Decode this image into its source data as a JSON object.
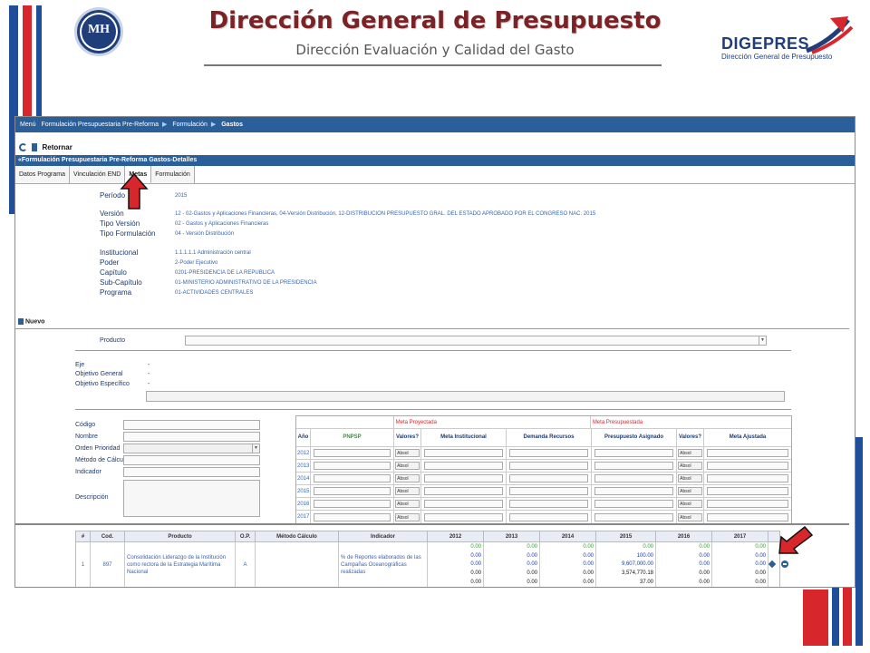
{
  "slide": {
    "title": "Dirección General de Presupuesto",
    "subtitle": "Dirección Evaluación y Calidad del Gasto",
    "seal_label": "MH",
    "brand_name": "DIGEPRES",
    "brand_sub": "Dirección General de Presupuesto"
  },
  "breadcrumb": [
    "Menú",
    "Formulación Presupuestaria Pre-Reforma",
    "Formulación",
    "Gastos"
  ],
  "toolbar": {
    "retornar_label": "Retornar"
  },
  "section_title": "Formulación Presupuestaria Pre-Reforma Gastos-Detalles",
  "tabs": [
    {
      "label": "Datos Programa",
      "active": false
    },
    {
      "label": "Vinculación END",
      "active": false
    },
    {
      "label": "Metas",
      "active": true
    },
    {
      "label": "Formulación",
      "active": false
    }
  ],
  "info": {
    "periodo_label": "Período",
    "periodo": "2015",
    "version_label": "Versión",
    "version": "12 - 02-Gastos y Aplicaciones Financieras, 04-Versión Distribución, 12-DISTRIBUCION PRESUPUESTO GRAL. DEL ESTADO APROBADO POR EL CONGRESO NAC. 2015",
    "tipo_version_label": "Tipo Versión",
    "tipo_version": "02 - Gastos y Aplicaciones Financieras",
    "tipo_formulacion_label": "Tipo Formulación",
    "tipo_formulacion": "04 - Versión Distribución",
    "institucional_label": "Institucional",
    "institucional": "1.1.1.1.1 Administración central",
    "poder_label": "Poder",
    "poder": "2-Poder Ejecutivo",
    "capitulo_label": "Capítulo",
    "capitulo": "0201-PRESIDENCIA DE LA REPUBLICA",
    "subcapitulo_label": "Sub-Capítulo",
    "subcapitulo": "01-MINISTERIO ADMINISTRATIVO DE LA PRESIDENCIA",
    "programa_label": "Programa",
    "programa": "01-ACTIVIDADES CENTRALES"
  },
  "nuevo_label": "Nuevo",
  "form": {
    "producto_label": "Producto",
    "eje_label": "Eje",
    "eje": "-",
    "objetivo_general_label": "Objetivo General",
    "objetivo_general": "-",
    "objetivo_especifico_label": "Objetivo Específico",
    "objetivo_especifico": "-",
    "codigo_label": "Código",
    "nombre_label": "Nombre",
    "orden_prioridad_label": "Orden Prioridad",
    "metodo_calculo_label": "Método de Cálculo",
    "indicador_label": "Indicador",
    "descripcion_label": "Descripción"
  },
  "goals_grid": {
    "meta_proyectada": "Meta Proyectada",
    "meta_presupuestada": "Meta Presupuestada",
    "headers": [
      "Año",
      "PNPSP",
      "Valores?",
      "Meta Institucional",
      "Demanda Recursos",
      "Presupuesto Asignado",
      "Valores?",
      "Meta Ajustada"
    ],
    "years": [
      "2012",
      "2013",
      "2014",
      "2015",
      "2016",
      "2017"
    ],
    "select_value": "Absol"
  },
  "results_table": {
    "headers": [
      "#",
      "Cod.",
      "Producto",
      "O.P.",
      "Método Cálculo",
      "Indicador",
      "2012",
      "2013",
      "2014",
      "2015",
      "2016",
      "2017"
    ],
    "row": {
      "num": "1",
      "cod": "897",
      "producto": "Consolidación Liderazgo de la Institución como rectora de la Estrategia Marítima Nacional",
      "op": "A",
      "metodo": "",
      "indicador": "% de Reportes elaborados de las Campañas Oceanográficas realizadas",
      "y2012": [
        "0.00",
        "0.00",
        "0.00",
        "0.00",
        "0.00"
      ],
      "y2013": [
        "0.00",
        "0.00",
        "0.00",
        "0.00",
        "0.00"
      ],
      "y2014": [
        "0.00",
        "0.00",
        "0.00",
        "0.00",
        "0.00"
      ],
      "y2015": [
        "0.00",
        "100.00",
        "9,607,000.00",
        "3,574,770.18",
        "37.00"
      ],
      "y2016": [
        "0.00",
        "0.00",
        "0.00",
        "0.00",
        "0.00"
      ],
      "y2017": [
        "0.00",
        "0.00",
        "0.00",
        "0.00",
        "0.00"
      ]
    }
  },
  "colors": {
    "accent_blue": "#2b5f99",
    "brand_red": "#d7262c",
    "title_maroon": "#7a2226"
  }
}
